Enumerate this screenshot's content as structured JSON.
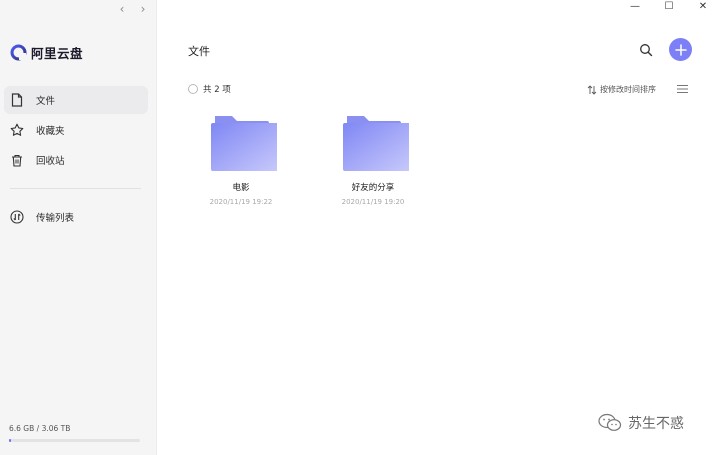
{
  "app": {
    "name": "阿里云盘"
  },
  "sidebar": {
    "items": [
      {
        "label": "文件",
        "icon": "file-icon",
        "active": true
      },
      {
        "label": "收藏夹",
        "icon": "star-icon",
        "active": false
      },
      {
        "label": "回收站",
        "icon": "trash-icon",
        "active": false
      }
    ],
    "transfer": {
      "label": "传输列表",
      "icon": "transfer-icon"
    },
    "storage": {
      "text": "6.6 GB / 3.06 TB",
      "used_fraction": 0.0021
    }
  },
  "main": {
    "title": "文件",
    "count_label": "共 2 项",
    "sort_label": "按修改时间排序",
    "folders": [
      {
        "name": "电影",
        "date": "2020/11/19 19:22"
      },
      {
        "name": "好友的分享",
        "date": "2020/11/19 19:20"
      }
    ]
  },
  "watermark": {
    "text": "苏生不惑"
  },
  "colors": {
    "accent": "#7c7ff6",
    "folder_top": "#8d94f5",
    "folder_bottom": "#c5c7fb",
    "sidebar_bg": "#f5f5f6"
  }
}
